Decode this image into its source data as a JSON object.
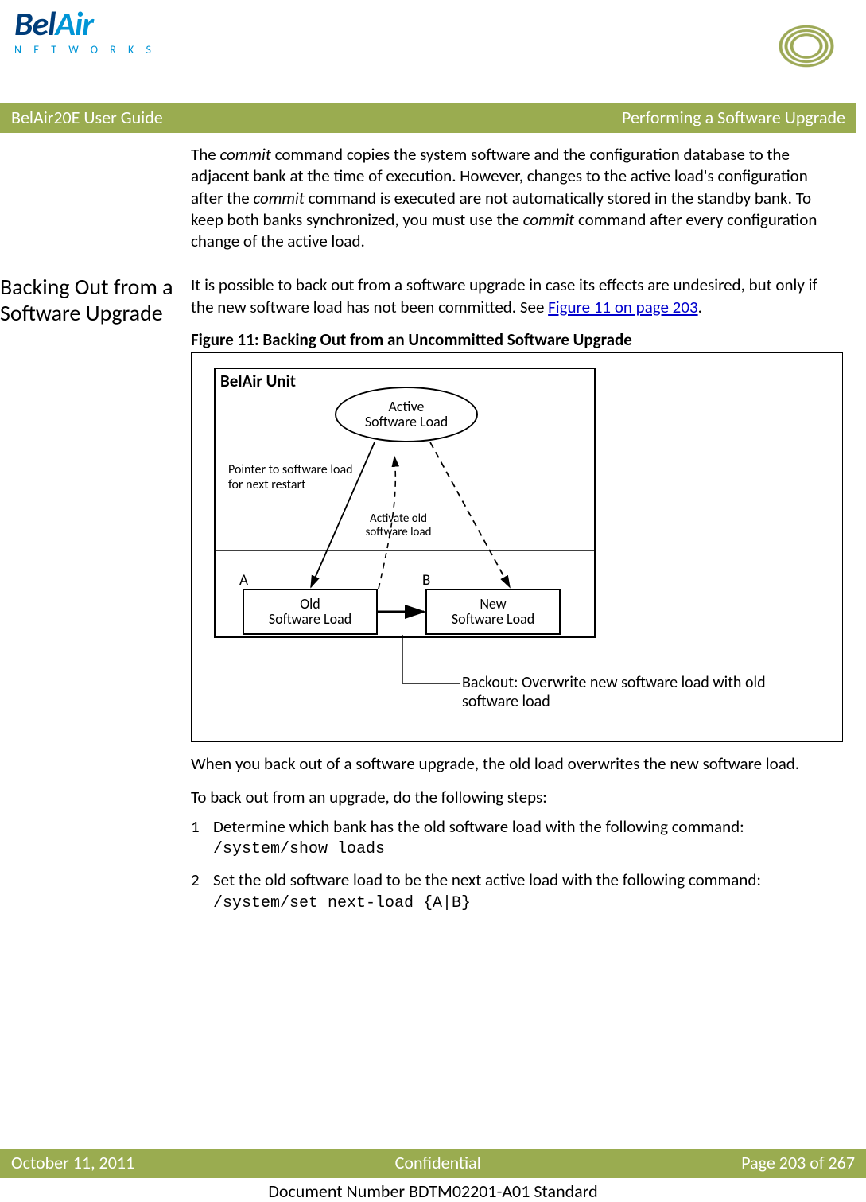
{
  "logo": {
    "bel": "Bel",
    "air": "Air",
    "networks": "N E T W O R K S"
  },
  "banner": {
    "left": "BelAir20E User Guide",
    "right": "Performing a Software Upgrade"
  },
  "intro_para": {
    "t1": "The ",
    "commit1": "commit",
    "t2": " command copies the system software and the configuration database to the adjacent bank at the time of execution. However, changes to the active load's configuration after the ",
    "commit2": "commit",
    "t3": " command is executed are not automatically stored in the standby bank. To keep both banks synchronized, you must use the ",
    "commit3": "commit",
    "t4": " command after every configuration change of the active load."
  },
  "section_heading": "Backing Out from a Software Upgrade",
  "section_para": {
    "t1": "It is possible to back out from a software upgrade in case its effects are undesired, but only if the new software load has not been committed. See ",
    "link": "Figure 11 on page 203",
    "t2": "."
  },
  "figure": {
    "caption": "Figure 11: Backing Out from an Uncommitted Software Upgrade",
    "unit_title": "BelAir Unit",
    "active_load": "Active\nSoftware Load",
    "pointer_text": "Pointer to software load for next restart",
    "activate_text": "Activate old software load",
    "bank_a": "A",
    "bank_b": "B",
    "old_load": "Old\nSoftware Load",
    "new_load": "New\nSoftware Load",
    "backout_text": "Backout: Overwrite new software load with old software load"
  },
  "after_figure_p1": "When you back out of a software upgrade, the old load overwrites the new software load.",
  "after_figure_p2": "To back out from an upgrade, do the following steps:",
  "steps": [
    {
      "num": "1",
      "text": "Determine which bank has the old software load with the following command:",
      "code": "/system/show loads"
    },
    {
      "num": "2",
      "text": "Set the old software load to be the next active load with the following command:",
      "code": "/system/set next-load {A|B}"
    }
  ],
  "footer": {
    "left": "October 11, 2011",
    "center": "Confidential",
    "right": "Page 203 of 267",
    "doc_number": "Document Number BDTM02201-A01 Standard"
  }
}
